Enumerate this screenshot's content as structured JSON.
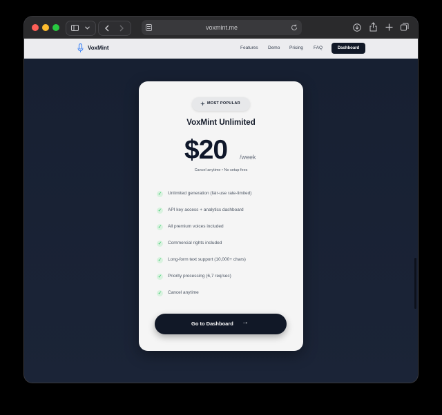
{
  "browser": {
    "url": "voxmint.me"
  },
  "site": {
    "brand": "VoxMint",
    "nav": [
      {
        "label": "Features"
      },
      {
        "label": "Demo"
      },
      {
        "label": "Pricing"
      },
      {
        "label": "FAQ"
      }
    ],
    "dashboard_label": "Dashboard"
  },
  "card": {
    "badge": "MOST POPULAR",
    "plan_name": "VoxMint Unlimited",
    "price": "$20",
    "period": "/week",
    "subtext": "Cancel anytime • No setup fees",
    "features": [
      "Unlimited generation (fair-use rate-limited)",
      "API key access + analytics dashboard",
      "All premium voices included",
      "Commercial rights included",
      "Long-form text support (10,000+ chars)",
      "Priority processing (6,7 req/sec)",
      "Cancel anytime"
    ],
    "cta": "Go to Dashboard"
  },
  "colors": {
    "accent": "#111827",
    "check": "#22c55e",
    "hero_bg": "#1a2233"
  },
  "icons": {
    "badge": "sparkle-icon",
    "logo": "microphone-icon",
    "cta": "arrow-right-icon"
  }
}
